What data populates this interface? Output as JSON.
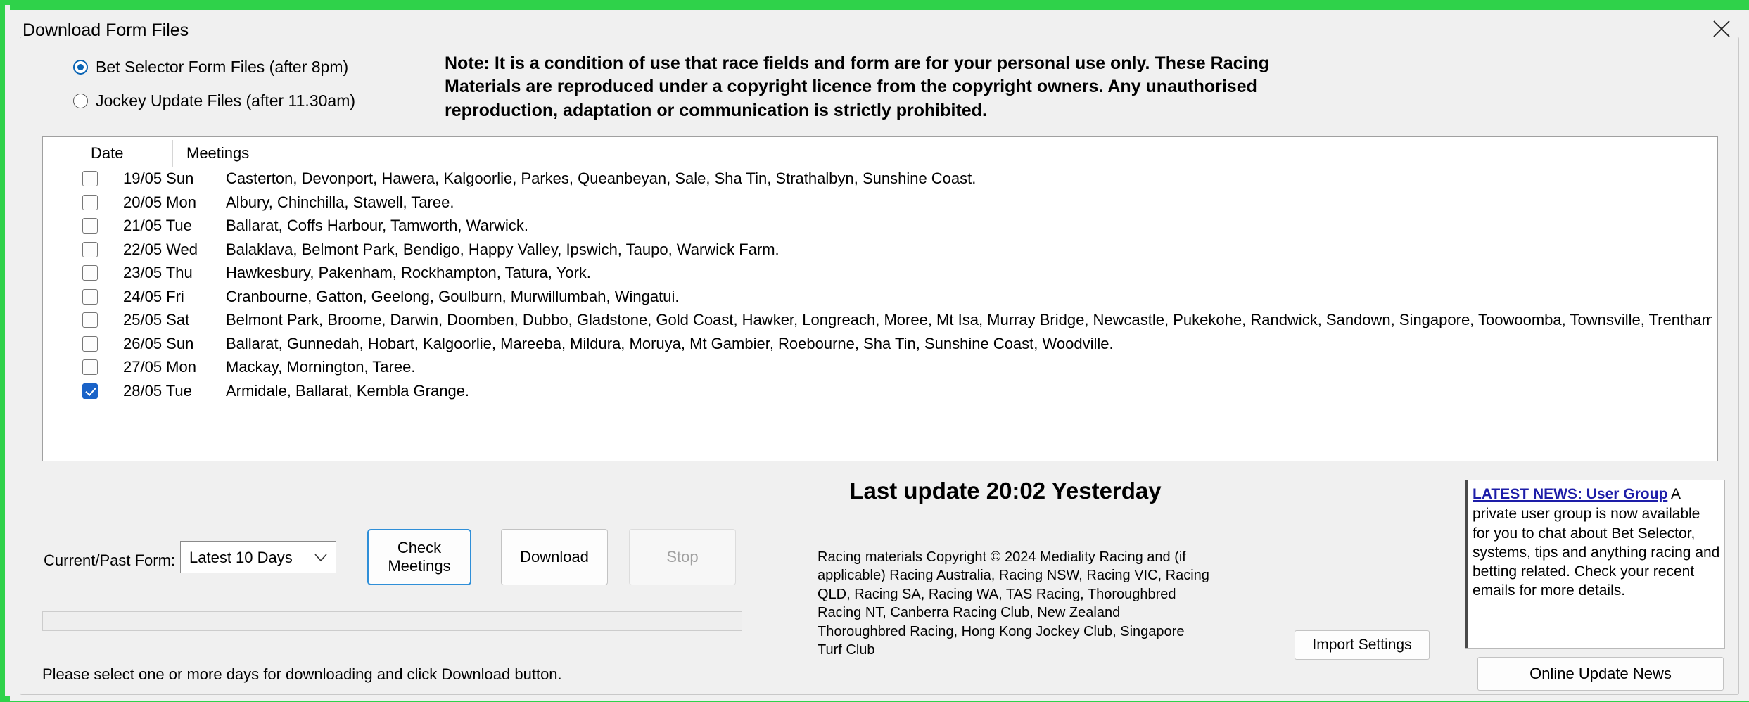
{
  "window": {
    "accent_border_color": "#2fd24a"
  },
  "dialog": {
    "title": "Download Form Files",
    "close_icon": "close-icon"
  },
  "options": {
    "bet_selector": {
      "label": "Bet Selector Form Files (after 8pm)",
      "selected": true
    },
    "jockey_update": {
      "label": "Jockey Update Files (after 11.30am)",
      "selected": false
    }
  },
  "note": "Note: It is a condition of use that race fields and form are for your personal use only. These Racing Materials are reproduced under a copyright licence from the copyright owners. Any unauthorised reproduction, adaptation or communication is strictly prohibited.",
  "table": {
    "columns": [
      "Date",
      "Meetings"
    ],
    "rows": [
      {
        "checked": false,
        "date": "19/05 Sun",
        "meetings": "Casterton, Devonport, Hawera, Kalgoorlie, Parkes, Queanbeyan, Sale, Sha Tin, Strathalbyn, Sunshine Coast."
      },
      {
        "checked": false,
        "date": "20/05 Mon",
        "meetings": "Albury, Chinchilla, Stawell, Taree."
      },
      {
        "checked": false,
        "date": "21/05 Tue",
        "meetings": "Ballarat, Coffs Harbour, Tamworth, Warwick."
      },
      {
        "checked": false,
        "date": "22/05 Wed",
        "meetings": "Balaklava, Belmont Park, Bendigo, Happy Valley, Ipswich, Taupo, Warwick Farm."
      },
      {
        "checked": false,
        "date": "23/05 Thu",
        "meetings": "Hawkesbury, Pakenham, Rockhampton, Tatura, York."
      },
      {
        "checked": false,
        "date": "24/05 Fri",
        "meetings": "Cranbourne, Gatton, Geelong, Goulburn, Murwillumbah, Wingatui."
      },
      {
        "checked": false,
        "date": "25/05 Sat",
        "meetings": "Belmont Park, Broome, Darwin, Doomben, Dubbo, Gladstone, Gold Coast, Hawker, Longreach, Moree, Mt Isa, Murray Bridge, Newcastle, Pukekohe, Randwick, Sandown, Singapore, Toowoomba, Townsville, Trentham, Wag..."
      },
      {
        "checked": false,
        "date": "26/05 Sun",
        "meetings": "Ballarat, Gunnedah, Hobart, Kalgoorlie, Mareeba, Mildura, Moruya, Mt Gambier, Roebourne, Sha Tin, Sunshine Coast, Woodville."
      },
      {
        "checked": false,
        "date": "27/05 Mon",
        "meetings": "Mackay, Mornington, Taree."
      },
      {
        "checked": true,
        "date": "28/05 Tue",
        "meetings": "Armidale, Ballarat, Kembla Grange."
      }
    ]
  },
  "last_update": "Last update 20:02 Yesterday",
  "copyright": "Racing materials Copyright © 2024 Mediality Racing and (if applicable) Racing Australia, Racing NSW, Racing VIC, Racing QLD, Racing SA, Racing WA, TAS Racing, Thoroughbred Racing NT, Canberra Racing Club, New Zealand Thoroughbred Racing, Hong Kong Jockey Club, Singapore Turf Club",
  "controls": {
    "form_label": "Current/Past Form:",
    "form_select_value": "Latest 10 Days",
    "check_meetings_label": "Check\nMeetings",
    "check_meetings_line1": "Check",
    "check_meetings_line2": "Meetings",
    "download_label": "Download",
    "stop_label": "Stop",
    "import_settings_label": "Import Settings",
    "online_update_news_label": "Online Update News"
  },
  "status_text": "Please select one or more days for downloading and click Download button.",
  "news": {
    "headline": "LATEST NEWS: User Group",
    "body": "A private user group is now available for you to chat about Bet Selector, systems, tips and anything racing and betting related. Check your recent emails for more details."
  },
  "colors": {
    "accent_blue": "#1a63c8",
    "focus_blue": "#2f8fd8",
    "news_link": "#1d1da8",
    "window_green": "#2fd24a"
  }
}
